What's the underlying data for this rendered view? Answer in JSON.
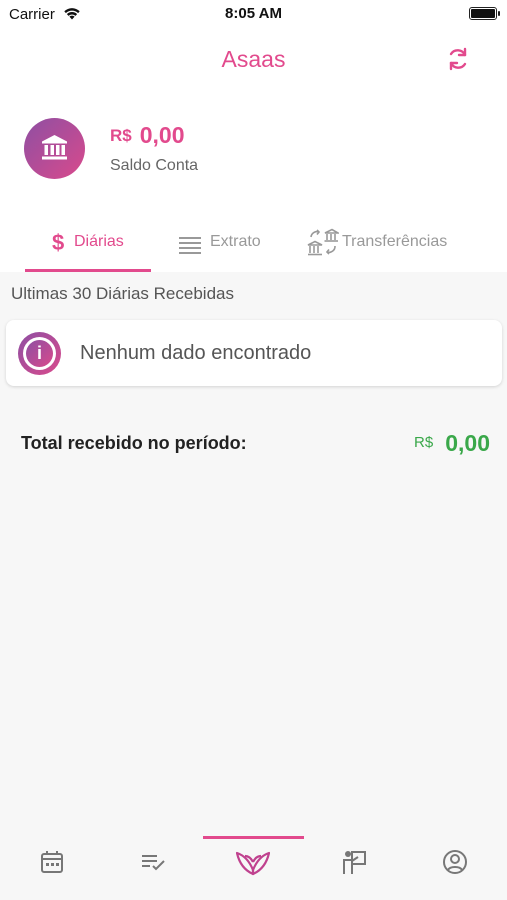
{
  "status_bar": {
    "carrier": "Carrier",
    "time": "8:05 AM"
  },
  "header": {
    "title": "Asaas",
    "refresh_icon": "refresh-icon"
  },
  "account": {
    "currency": "R$",
    "balance": "0,00",
    "label": "Saldo Conta",
    "icon": "bank-icon"
  },
  "tabs": [
    {
      "label": "Diárias",
      "icon": "dollar-icon",
      "active": true
    },
    {
      "label": "Extrato",
      "icon": "list-icon",
      "active": false
    },
    {
      "label": "Transferências",
      "icon": "transfer-icon",
      "active": false
    }
  ],
  "section": {
    "caption": "Ultimas 30 Diárias Recebidas",
    "empty_message": "Nenhum dado encontrado",
    "empty_icon": "info-icon"
  },
  "total": {
    "label": "Total recebido no período:",
    "currency": "R$",
    "value": "0,00"
  },
  "bottom_nav": [
    {
      "icon": "calendar-icon",
      "active": false
    },
    {
      "icon": "checklist-icon",
      "active": false
    },
    {
      "icon": "butterfly-icon",
      "active": true
    },
    {
      "icon": "teacher-icon",
      "active": false
    },
    {
      "icon": "profile-icon",
      "active": false
    }
  ],
  "colors": {
    "accent": "#e24a8d",
    "gradient_start": "#8e4fa3",
    "gradient_end": "#d94a8c",
    "positive": "#3aa84a",
    "inactive": "#999999"
  }
}
